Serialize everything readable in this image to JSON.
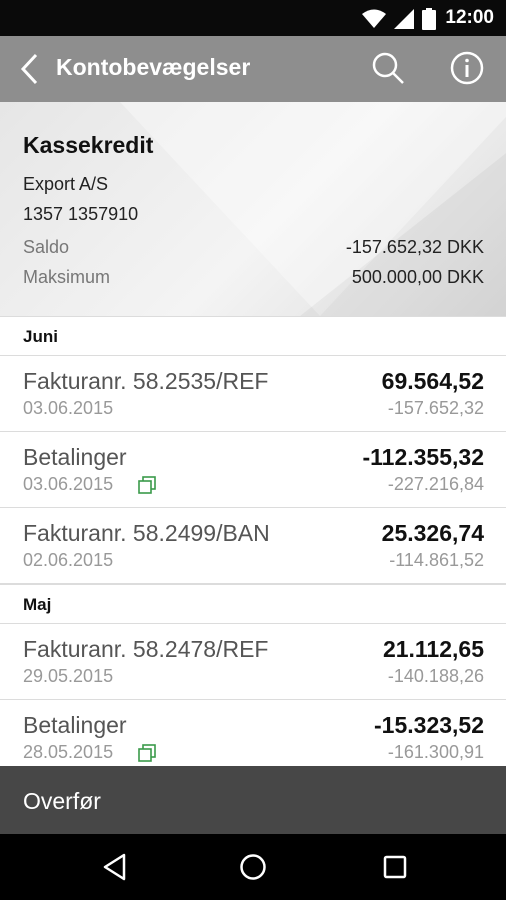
{
  "status_bar": {
    "time": "12:00",
    "icons": [
      "wifi-icon",
      "signal-icon",
      "battery-icon"
    ]
  },
  "app_bar": {
    "title": "Kontobevægelser",
    "icons": [
      "back-arrow-icon",
      "search-icon",
      "info-icon"
    ]
  },
  "account": {
    "name": "Kassekredit",
    "owner": "Export A/S",
    "number": "1357 1357910",
    "saldo_label": "Saldo",
    "saldo_value": "-157.652,32 DKK",
    "maksimum_label": "Maksimum",
    "maksimum_value": "500.000,00 DKK"
  },
  "sections": [
    {
      "title": "Juni",
      "transactions": [
        {
          "description": "Fakturanr. 58.2535/REF",
          "date": "03.06.2015",
          "amount": "69.564,52",
          "balance": "-157.652,32",
          "has_copy_icon": false
        },
        {
          "description": "Betalinger",
          "date": "03.06.2015",
          "amount": "-112.355,32",
          "balance": "-227.216,84",
          "has_copy_icon": true
        },
        {
          "description": "Fakturanr. 58.2499/BAN",
          "date": "02.06.2015",
          "amount": "25.326,74",
          "balance": "-114.861,52",
          "has_copy_icon": false
        }
      ]
    },
    {
      "title": "Maj",
      "transactions": [
        {
          "description": "Fakturanr. 58.2478/REF",
          "date": "29.05.2015",
          "amount": "21.112,65",
          "balance": "-140.188,26",
          "has_copy_icon": false
        },
        {
          "description": "Betalinger",
          "date": "28.05.2015",
          "amount": "-15.323,52",
          "balance": "-161.300,91",
          "has_copy_icon": true
        }
      ]
    }
  ],
  "bottom_action": {
    "label": "Overfør"
  },
  "nav_bar": {
    "icons": [
      "back-triangle-icon",
      "home-circle-icon",
      "recents-square-icon"
    ]
  },
  "colors": {
    "app_bar": "#8e8e8e",
    "bottom_action": "#474747",
    "copy_icon": "#3a9a4a"
  }
}
